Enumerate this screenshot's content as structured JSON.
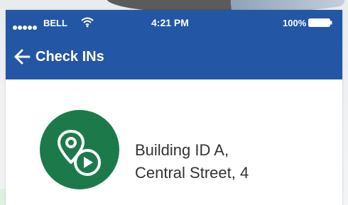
{
  "status_bar": {
    "carrier": "BELL",
    "time": "4:21 PM",
    "battery": "100%"
  },
  "nav": {
    "title": "Check INs",
    "back_icon": "arrow-left-icon"
  },
  "checkin": {
    "icon": "location-pin-play-icon",
    "line1": "Building ID A,",
    "line2": "Central Street, 4"
  },
  "colors": {
    "header": "#2456a6",
    "badge": "#1c7a4a",
    "text": "#333333"
  }
}
